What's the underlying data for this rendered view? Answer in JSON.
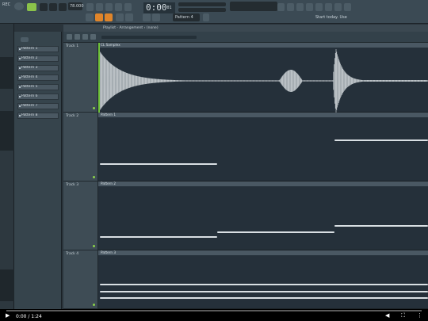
{
  "toolbar": {
    "tempo": "78.000",
    "time_display": "0:00",
    "time_small": "01",
    "pattern_selector": "Pattern 4",
    "small_label": "REC",
    "right_label": "Start today. Use"
  },
  "browser": {
    "patterns": [
      "Pattern 1",
      "Pattern 2",
      "Pattern 3",
      "Pattern 4",
      "Pattern 5",
      "Pattern 6",
      "Pattern 7",
      "Pattern 8"
    ]
  },
  "playlist": {
    "title": "Playlist - Arrangement › (none)",
    "tracks": [
      {
        "name": "Track 1",
        "clip": "CL Samplex"
      },
      {
        "name": "Track 2",
        "clip": "Pattern 1"
      },
      {
        "name": "Track 3",
        "clip": "Pattern 2"
      },
      {
        "name": "Track 4",
        "clip": "Pattern 3"
      }
    ]
  },
  "video": {
    "time": "0:00 / 1:24",
    "progress": 0
  },
  "colors": {
    "accent_orange": "#e0852a",
    "led_green": "#8ad14a",
    "note_white": "#d9dfe3"
  }
}
